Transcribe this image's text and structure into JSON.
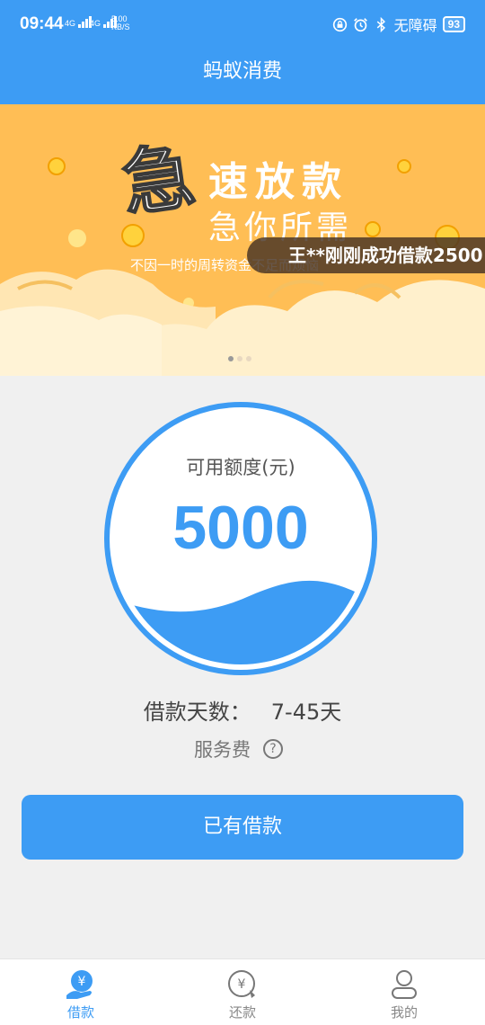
{
  "status_bar": {
    "time": "09:44",
    "signal1": "4G",
    "signal2": "4G",
    "net_speed": "5.00",
    "net_unit": "KB/S",
    "accessibility": "无障碍",
    "battery": "93",
    "icons": [
      "lock-icon",
      "alarm-icon",
      "bluetooth-icon"
    ]
  },
  "header": {
    "title": "蚂蚁消费"
  },
  "banner": {
    "big_char": "急",
    "headline1": "速放款",
    "headline2": "急你所需",
    "tagline": "不因一时的周转资金不足而烦恼",
    "ticker": "王**刚刚成功借款2500",
    "dots": 3,
    "active_dot": 0,
    "bg_color": "#ffbe55"
  },
  "credit": {
    "label": "可用额度(元)",
    "amount": "5000",
    "fill_level": 0.3
  },
  "loan_days": {
    "label": "借款天数：",
    "value": "7-45天"
  },
  "service_fee": {
    "label": "服务费",
    "help": "?"
  },
  "primary_button": {
    "label": "已有借款"
  },
  "tabs": [
    {
      "label": "借款",
      "icon": "loan-icon",
      "active": true
    },
    {
      "label": "还款",
      "icon": "repay-icon",
      "active": false
    },
    {
      "label": "我的",
      "icon": "profile-icon",
      "active": false
    }
  ],
  "colors": {
    "primary": "#3d9cf4",
    "banner": "#ffbe55"
  }
}
